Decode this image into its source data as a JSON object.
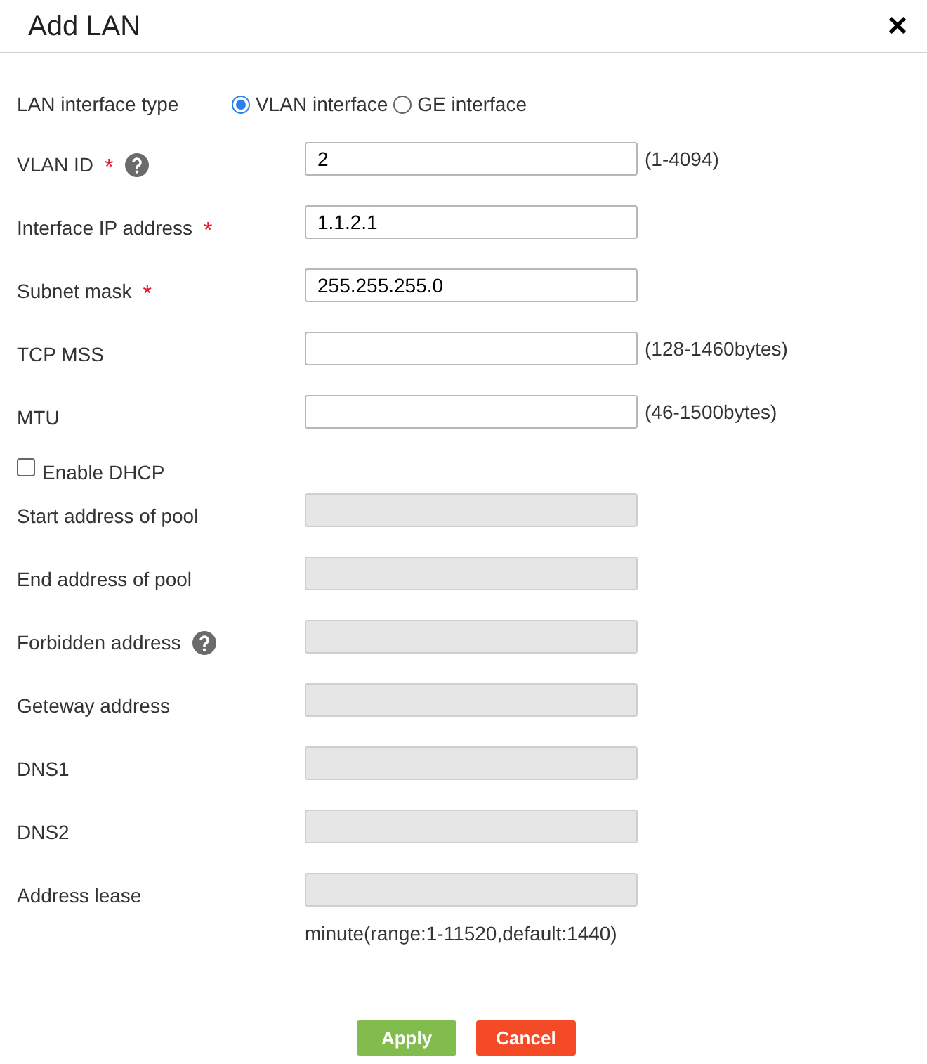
{
  "dialog": {
    "title": "Add LAN",
    "close": "×"
  },
  "interface_type": {
    "label": "LAN interface type",
    "options": [
      {
        "label": "VLAN interface",
        "selected": true
      },
      {
        "label": "GE interface",
        "selected": false
      }
    ]
  },
  "rows": [
    {
      "kind": "input",
      "label": "VLAN ID",
      "required_mark": "*",
      "help": true,
      "value": "2",
      "hint": "(1-4094)",
      "disabled": false
    },
    {
      "kind": "input",
      "label": "Interface IP address",
      "required_mark": "*",
      "help": false,
      "value": "1.1.2.1",
      "disabled": false
    },
    {
      "kind": "input",
      "label": "Subnet mask",
      "required_mark": "*",
      "help": false,
      "value": "255.255.255.0",
      "disabled": false
    },
    {
      "kind": "input",
      "label": "TCP MSS",
      "help": false,
      "hint": "(128-1460bytes)",
      "disabled": false
    },
    {
      "kind": "input",
      "label": "MTU",
      "help": false,
      "hint": "(46-1500bytes)",
      "disabled": false
    },
    {
      "kind": "checkbox",
      "label": "Enable DHCP",
      "checked": false
    },
    {
      "kind": "input",
      "label": "Start address of pool",
      "help": false,
      "disabled": true
    },
    {
      "kind": "input",
      "label": "End address of pool",
      "help": false,
      "disabled": true
    },
    {
      "kind": "input",
      "label": "Forbidden address",
      "help": true,
      "disabled": true
    },
    {
      "kind": "input",
      "label": "Geteway address",
      "help": false,
      "disabled": true
    },
    {
      "kind": "input",
      "label": "DNS1",
      "help": false,
      "disabled": true
    },
    {
      "kind": "input",
      "label": "DNS2",
      "help": false,
      "disabled": true
    },
    {
      "kind": "input",
      "label": "Address lease",
      "help": false,
      "disabled": true
    }
  ],
  "lease_note": "minute(range:1-11520,default:1440)",
  "buttons": [
    {
      "kind": "primary",
      "label": "Apply"
    },
    {
      "kind": "danger",
      "label": "Cancel"
    }
  ]
}
